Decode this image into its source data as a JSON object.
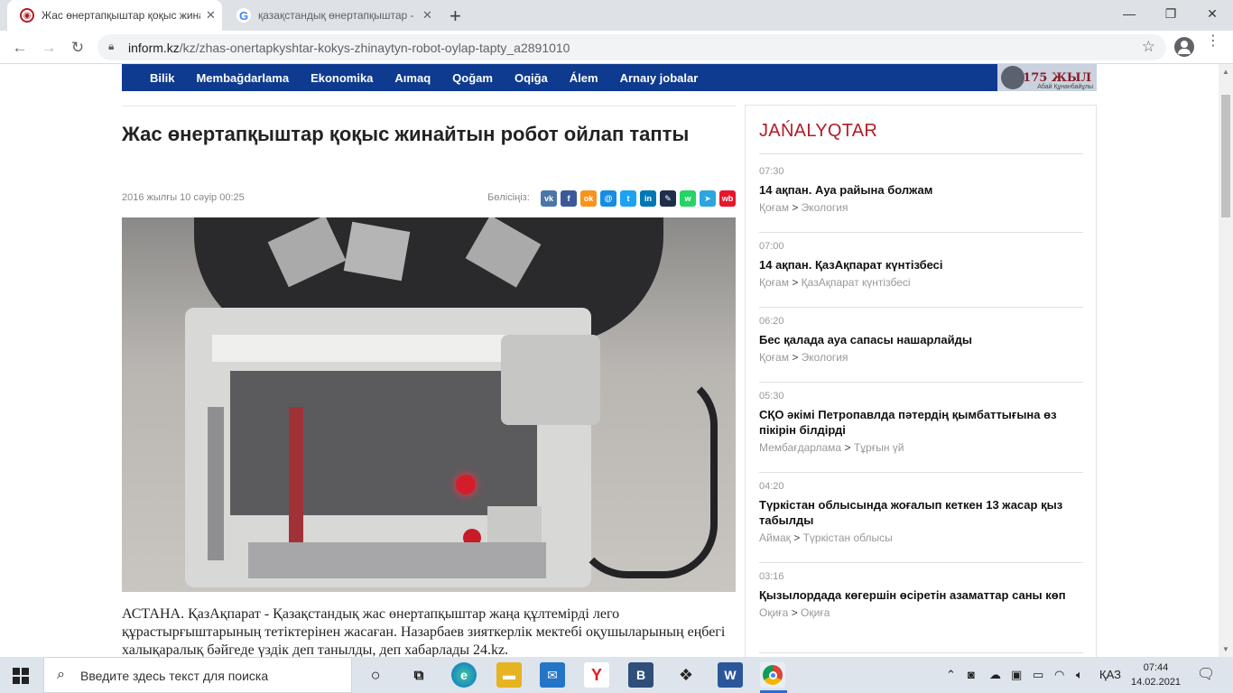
{
  "browser": {
    "tabs": [
      {
        "title": "Жас өнертапқыштар қоқыс жина",
        "active": true
      },
      {
        "title": "қазақстандық өнертапқыштар - G",
        "active": false
      }
    ],
    "new_tab": "+",
    "window": {
      "minimize": "—",
      "maximize": "❐",
      "close": "✕"
    },
    "url_domain": "inform.kz",
    "url_path": "/kz/zhas-onertapkyshtar-kokys-zhinaytyn-robot-oylap-tapty_a2891010"
  },
  "site": {
    "nav": [
      "Bilik",
      "Membağdarlama",
      "Ekonomika",
      "Aımaq",
      "Qoğam",
      "Oqiğa",
      "Álem",
      "Arnaıy jobalar"
    ],
    "banner_text": "175 ЖЫЛ",
    "banner_sub": "Абай Құнанбайұлы"
  },
  "article": {
    "title": "Жас өнертапқыштар қоқыс жинайтын робот ойлап тапты",
    "date": "2016 жылғы 10 сәуір 00:25",
    "share_label": "Бөлісіңіз:",
    "share_icons": [
      {
        "name": "vk-icon",
        "glyph": "vk",
        "color": "#4a76a8"
      },
      {
        "name": "facebook-icon",
        "glyph": "f",
        "color": "#3b5998"
      },
      {
        "name": "odnoklassniki-icon",
        "glyph": "ok",
        "color": "#f7931e"
      },
      {
        "name": "moimir-icon",
        "glyph": "@",
        "color": "#168de2"
      },
      {
        "name": "twitter-icon",
        "glyph": "t",
        "color": "#1da1f2"
      },
      {
        "name": "linkedin-icon",
        "glyph": "in",
        "color": "#0077b5"
      },
      {
        "name": "livejournal-icon",
        "glyph": "✎",
        "color": "#1f2e4a"
      },
      {
        "name": "whatsapp-icon",
        "glyph": "w",
        "color": "#25d366"
      },
      {
        "name": "telegram-icon",
        "glyph": "➤",
        "color": "#2ca5e0"
      },
      {
        "name": "weibo-icon",
        "glyph": "wb",
        "color": "#e6162d"
      }
    ],
    "lead": "АСТАНА. ҚазАқпарат - Қазақстандық жас өнертапқыштар жаңа құлтемірді лего құрастырғыштарының тетіктерінен жасаған. Назарбаев зияткерлік мектебі оқушыларының еңбегі халықаралық бәйгеде үздік деп танылды, деп хабарлады 24.kz."
  },
  "sidebar": {
    "title": "JAŃALYQTAR",
    "news": [
      {
        "time": "07:30",
        "headline": "14 ақпан. Ауа райына болжам",
        "cat": "Қоғам",
        "sub": "Экология"
      },
      {
        "time": "07:00",
        "headline": "14 ақпан. ҚазАқпарат күнтізбесі",
        "cat": "Қоғам",
        "sub": "ҚазАқпарат күнтізбесі"
      },
      {
        "time": "06:20",
        "headline": "Бес қалада ауа сапасы нашарлайды",
        "cat": "Қоғам",
        "sub": "Экология"
      },
      {
        "time": "05:30",
        "headline": "СҚО әкімі Петропавлда пәтердің қымбаттығына өз пікірін білдірді",
        "cat": "Мембағдарлама",
        "sub": "Тұрғын үй"
      },
      {
        "time": "04:20",
        "headline": "Түркістан облысында жоғалып кеткен 13 жасар қыз табылды",
        "cat": "Аймақ",
        "sub": "Түркістан облысы"
      },
      {
        "time": "03:16",
        "headline": "Қызылордада көгершін өсіретін азаматтар саны көп",
        "cat": "Оқиға",
        "sub": "Оқиға"
      }
    ],
    "separator": ">"
  },
  "taskbar": {
    "search_placeholder": "Введите здесь текст для поиска",
    "lang": "ҚАЗ",
    "time": "07:44",
    "date": "14.02.2021"
  }
}
